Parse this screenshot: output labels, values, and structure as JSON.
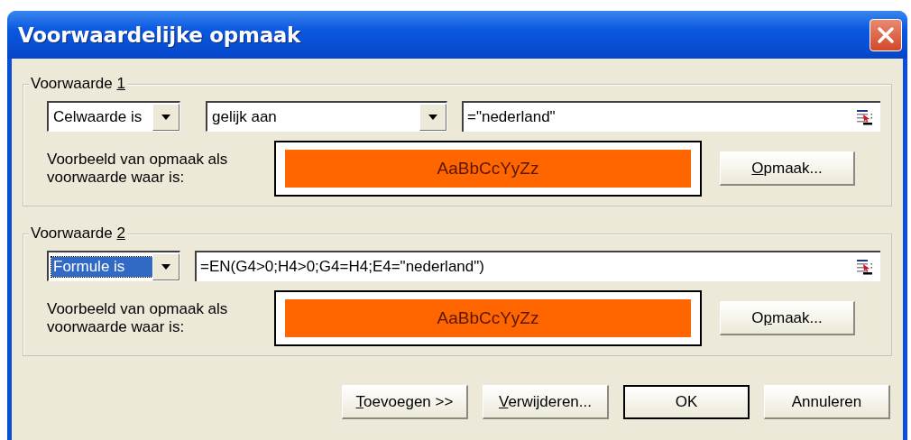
{
  "window": {
    "title": "Voorwaardelijke opmaak"
  },
  "conditions": [
    {
      "label": [
        {
          "text": "Voorwaarde ",
          "underlined": false
        },
        {
          "text": "1",
          "underlined": true
        }
      ],
      "controls": [
        {
          "kind": "combo",
          "value": "Celwaarde is",
          "selected": false
        },
        {
          "kind": "combo",
          "value": "gelijk aan",
          "selected": false
        },
        {
          "kind": "field",
          "value": "=\"nederland\""
        }
      ],
      "preview_label": "Voorbeeld van opmaak als voorwaarde waar is:",
      "preview_text": "AaBbCcYyZz",
      "format_button": [
        {
          "text": "O",
          "underlined": true
        },
        {
          "text": "pmaak...",
          "underlined": false
        }
      ]
    },
    {
      "label": [
        {
          "text": "Voorwaarde ",
          "underlined": false
        },
        {
          "text": "2",
          "underlined": true
        }
      ],
      "controls": [
        {
          "kind": "combo",
          "value": "Formule is",
          "selected": true
        },
        {
          "kind": "field",
          "value": "=EN(G4>0;H4>0;G4=H4;E4=\"nederland\")"
        }
      ],
      "preview_label": "Voorbeeld van opmaak als voorwaarde waar is:",
      "preview_text": "AaBbCcYyZz",
      "format_button": [
        {
          "text": "O",
          "underlined": false
        },
        {
          "text": "p",
          "underlined": true
        },
        {
          "text": "maak...",
          "underlined": false
        }
      ]
    }
  ],
  "buttons": [
    {
      "label": [
        {
          "text": "T",
          "underlined": true
        },
        {
          "text": "oevoegen >>",
          "underlined": false
        }
      ],
      "default": false
    },
    {
      "label": [
        {
          "text": "V",
          "underlined": true
        },
        {
          "text": "erwijderen...",
          "underlined": false
        }
      ],
      "default": false
    },
    {
      "label": [
        {
          "text": "OK",
          "underlined": false
        }
      ],
      "default": true
    },
    {
      "label": [
        {
          "text": "Annuleren",
          "underlined": false
        }
      ],
      "default": false
    }
  ]
}
